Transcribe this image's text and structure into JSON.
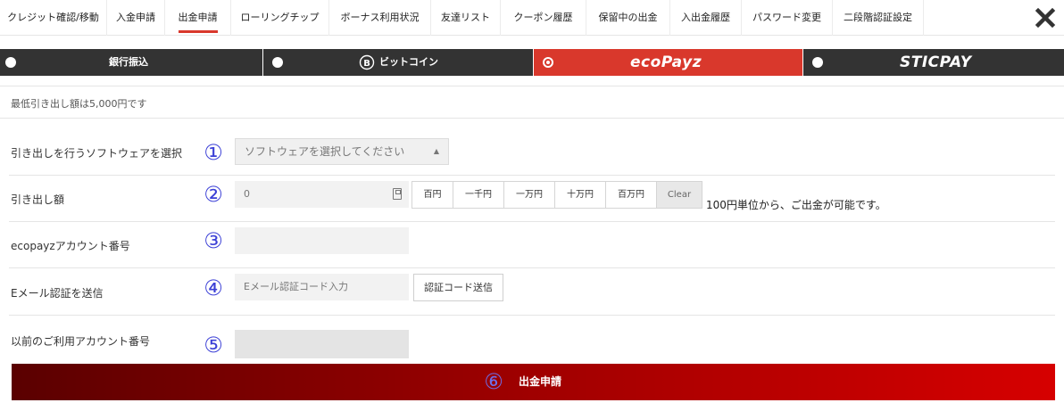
{
  "nav": {
    "tabs": [
      {
        "label": "クレジット確認/移動"
      },
      {
        "label": "入金申請"
      },
      {
        "label": "出金申請"
      },
      {
        "label": "ローリングチップ"
      },
      {
        "label": "ボーナス利用状況"
      },
      {
        "label": "友達リスト"
      },
      {
        "label": "クーポン履歴"
      },
      {
        "label": "保留中の出金"
      },
      {
        "label": "入出金履歴"
      },
      {
        "label": "パスワード変更"
      },
      {
        "label": "二段階認証設定"
      }
    ],
    "active_tab": "出金申請",
    "close_icon": "close-x-icon"
  },
  "methods": [
    {
      "label": "銀行振込",
      "selected": false
    },
    {
      "label": "ビットコイン",
      "selected": false,
      "icon": "bitcoin-icon"
    },
    {
      "label": "ecoPayz",
      "selected": true
    },
    {
      "label": "STICPAY",
      "selected": false
    }
  ],
  "notice": "最低引き出し額は5,000円です",
  "form": {
    "software": {
      "label": "引き出しを行うソフトウェアを選択",
      "number": "①",
      "placeholder": "ソフトウェアを選択してください"
    },
    "amount": {
      "label": "引き出し額",
      "number": "②",
      "value": "0",
      "units": [
        "百円",
        "一千円",
        "一万円",
        "十万円",
        "百万円"
      ],
      "clear_label": "Clear",
      "note": "100円単位から、ご出金が可能です。"
    },
    "account": {
      "label": "ecopayzアカウント番号",
      "number": "③",
      "value": ""
    },
    "email": {
      "label": "Eメール認証を送信",
      "number": "④",
      "placeholder": "Eメール認証コード入力",
      "send_label": "認証コード送信"
    },
    "previous": {
      "label": "以前のご利用アカウント番号",
      "number": "⑤",
      "value": ""
    }
  },
  "submit": {
    "number": "⑥",
    "label": "出金申請"
  },
  "colors": {
    "accent": "#d9382c",
    "method_bar": "#333333",
    "number_blue": "#3b3fd6",
    "submit_start": "#5a0000",
    "submit_end": "#d60000"
  }
}
